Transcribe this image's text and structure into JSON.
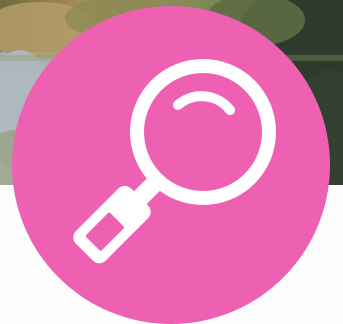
{
  "banner": {
    "image": "outdoor-pond-photo"
  },
  "badge": {
    "icon": "magnifying-glass-icon",
    "color": "#EE61B2",
    "glyph_color": "#FFFFFF"
  },
  "colors": {
    "water": "#A7B3BC",
    "foliage_dark": "#2F3A2A",
    "foliage_light": "#8E9A6A",
    "earth": "#B49A6E",
    "panel": "#FDFDFD"
  }
}
